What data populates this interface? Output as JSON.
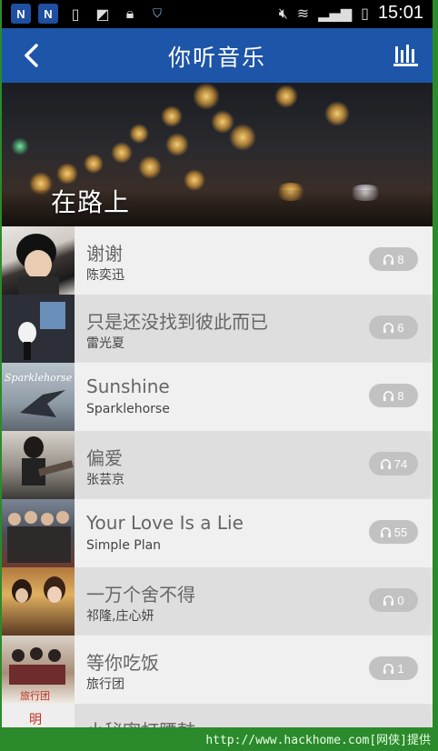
{
  "status_bar": {
    "time": "15:01",
    "left_icons": [
      "n-icon",
      "n-icon",
      "battery-saver-icon",
      "image-icon",
      "lock-icon",
      "shield-icon"
    ],
    "right_icons": [
      "mute-icon",
      "wifi-icon",
      "signal-icon",
      "battery-icon"
    ]
  },
  "header": {
    "title": "你听音乐",
    "back_icon": "chevron-left-icon",
    "right_icon": "equalizer-icon"
  },
  "hero": {
    "caption": "在路上"
  },
  "songs": [
    {
      "title": "谢谢",
      "artist": "陈奕迅",
      "count": "8"
    },
    {
      "title": "只是还没找到彼此而已",
      "artist": "雷光夏",
      "count": "6"
    },
    {
      "title": "Sunshine",
      "artist": "Sparklehorse",
      "count": "8",
      "cover_text": "Sparklehorse"
    },
    {
      "title": "偏爱",
      "artist": "张芸京",
      "count": "74"
    },
    {
      "title": "Your Love Is a Lie",
      "artist": "Simple Plan",
      "count": "55"
    },
    {
      "title": "一万个舍不得",
      "artist": "祁隆,庄心妍",
      "count": "0"
    },
    {
      "title": "等你吃饭",
      "artist": "旅行团",
      "count": "1"
    },
    {
      "title": "小秘密打腰鼓",
      "artist": "",
      "count": ""
    }
  ],
  "colors": {
    "header_bg": "#1d55a8",
    "badge_bg": "#c2c2c2",
    "watermark_bg": "#2b8a2b"
  },
  "watermark": {
    "text": "http://www.hackhome.com[网侠]提供"
  }
}
